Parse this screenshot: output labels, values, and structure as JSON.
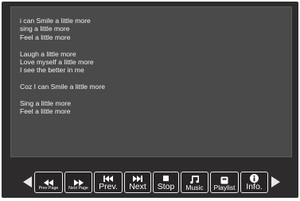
{
  "lyrics": {
    "lines": [
      "i can Smile a little more",
      "sing a little more",
      "Feel a little more",
      "",
      "Laugh a little more",
      "Love myself a little more",
      "I see the better in me",
      "",
      "Coz I can Smile a little more",
      "",
      "Sing a little more",
      "Feel a little more"
    ]
  },
  "controls": {
    "prev_page": {
      "label": "Prev Page",
      "icon": "rewind-icon"
    },
    "next_page": {
      "label": "Next Page",
      "icon": "fast-forward-icon"
    },
    "prev": {
      "label": "Prev.",
      "icon": "skip-previous-icon"
    },
    "next": {
      "label": "Next",
      "icon": "skip-next-icon"
    },
    "stop": {
      "label": "Stop",
      "icon": "stop-icon"
    },
    "music": {
      "label": "Music",
      "icon": "music-note-icon"
    },
    "playlist": {
      "label": "Playlist",
      "icon": "playlist-icon"
    },
    "info": {
      "label": "Info.",
      "icon": "info-icon"
    }
  }
}
